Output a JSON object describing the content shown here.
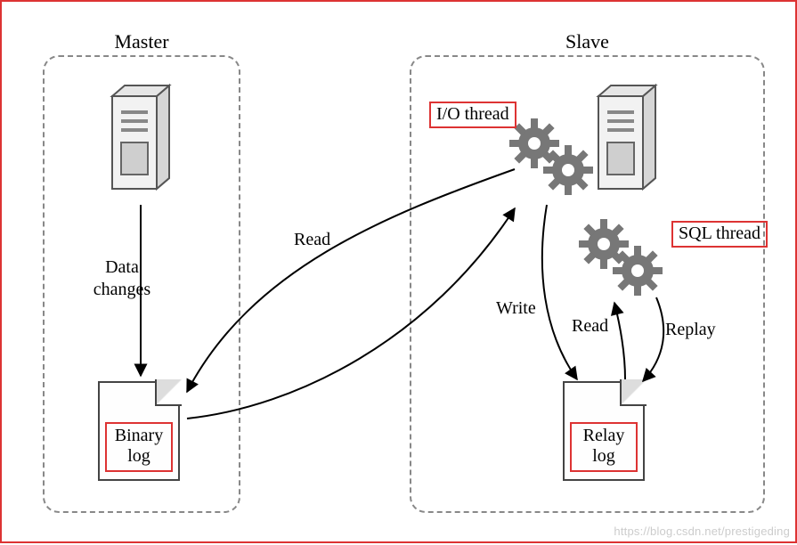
{
  "diagram": {
    "master": {
      "title": "Master",
      "binlog_label": "Binary log",
      "data_changes_label": "Data\nchanges"
    },
    "slave": {
      "title": "Slave",
      "io_thread_label": "I/O thread",
      "sql_thread_label": "SQL thread",
      "relay_log_label": "Relay log"
    },
    "edges": {
      "read_label": "Read",
      "write_label": "Write",
      "read2_label": "Read",
      "replay_label": "Replay"
    }
  },
  "watermark": "https://blog.csdn.net/prestigeding"
}
